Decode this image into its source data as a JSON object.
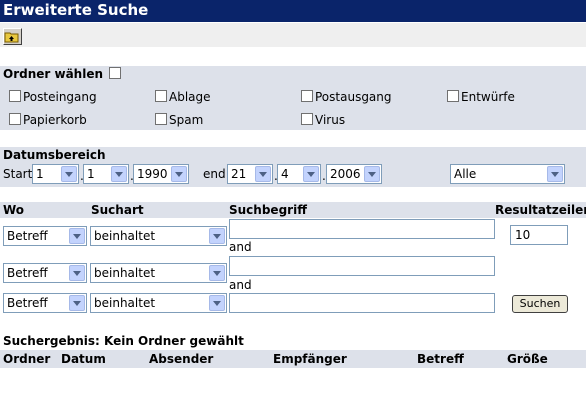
{
  "title": "Erweiterte Suche",
  "folder": {
    "label": "Ordner wählen",
    "items": [
      "Posteingang",
      "Ablage",
      "Postausgang",
      "Entwürfe",
      "Papierkorb",
      "Spam",
      "Virus"
    ]
  },
  "date": {
    "label": "Datumsbereich",
    "start_label": "Start",
    "end_label": "end",
    "start_day": "1",
    "start_month": "1",
    "start_year": "1990",
    "end_day": "21",
    "end_month": "4",
    "end_year": "2006",
    "range": "Alle"
  },
  "search": {
    "headers": {
      "where": "Wo",
      "type": "Suchart",
      "term": "Suchbegriff",
      "results": "Resultatzeilen"
    },
    "rows": [
      {
        "where": "Betreff",
        "type": "beinhaltet",
        "term": ""
      },
      {
        "where": "Betreff",
        "type": "beinhaltet",
        "term": ""
      },
      {
        "where": "Betreff",
        "type": "beinhaltet",
        "term": ""
      }
    ],
    "and_label": "and",
    "results_value": "10",
    "search_button": "Suchen"
  },
  "result": {
    "heading": "Suchergebnis: Kein Ordner gewählt",
    "columns": [
      "Ordner",
      "Datum",
      "Absender",
      "Empfänger",
      "Betreff",
      "Größe"
    ]
  }
}
